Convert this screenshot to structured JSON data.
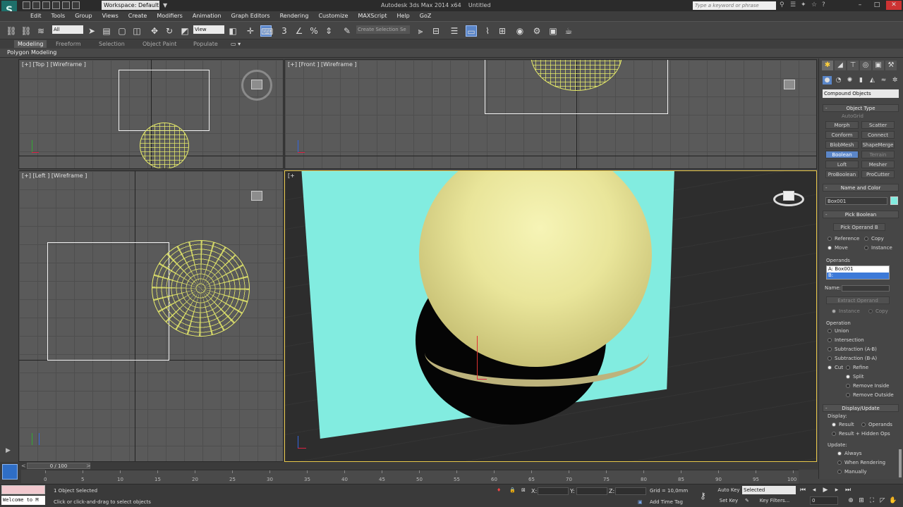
{
  "window": {
    "title": "Autodesk 3ds Max 2014 x64",
    "document": "Untitled",
    "workspace": "Workspace: Default",
    "search_placeholder": "Type a keyword or phrase"
  },
  "menu": [
    "Edit",
    "Tools",
    "Group",
    "Views",
    "Create",
    "Modifiers",
    "Animation",
    "Graph Editors",
    "Rendering",
    "Customize",
    "MAXScript",
    "Help",
    "GoZ"
  ],
  "toolbar": {
    "selection_filter": "All",
    "reference_coord": "View",
    "named_selection": "Create Selection Se"
  },
  "ribbon": {
    "tabs": [
      "Modeling",
      "Freeform",
      "Selection",
      "Object Paint",
      "Populate"
    ],
    "panel_label": "Polygon Modeling"
  },
  "viewports": {
    "top": "[+] [Top ] [Wireframe ]",
    "front": "[+] [Front ] [Wireframe ]",
    "left": "[+] [Left ] [Wireframe ]",
    "perspective": "[+"
  },
  "command_panel": {
    "category": "Compound Objects",
    "object_type_title": "Object Type",
    "autogrid_label": "AutoGrid",
    "object_types": [
      "Morph",
      "Scatter",
      "Conform",
      "Connect",
      "BlobMesh",
      "ShapeMerge",
      "Boolean",
      "Terrain",
      "Loft",
      "Mesher",
      "ProBoolean",
      "ProCutter"
    ],
    "active_type": "Boolean",
    "name_color_title": "Name and Color",
    "object_name": "Box001",
    "object_color": "#82ece0",
    "pick_boolean_title": "Pick Boolean",
    "pick_operand_label": "Pick Operand B",
    "pick_mode": [
      "Reference",
      "Copy",
      "Move",
      "Instance"
    ],
    "operands_title": "Operands",
    "operands": [
      "A: Box001",
      "B:"
    ],
    "name_label": "Name:",
    "extract_label": "Extract Operand",
    "extract_modes": [
      "Instance",
      "Copy"
    ],
    "operation_title": "Operation",
    "operations": [
      "Union",
      "Intersection",
      "Subtraction (A-B)",
      "Subtraction (B-A)",
      "Cut"
    ],
    "cut_modes": [
      "Refine",
      "Split",
      "Remove Inside",
      "Remove Outside"
    ],
    "display_update_title": "Display/Update",
    "display_label": "Display:",
    "display_options": [
      "Result",
      "Operands",
      "Result + Hidden Ops"
    ],
    "update_label": "Update:",
    "update_options": [
      "Always",
      "When Rendering",
      "Manually"
    ]
  },
  "timeline": {
    "frame_label": "0 / 100",
    "ticks": [
      "0",
      "5",
      "10",
      "15",
      "20",
      "25",
      "30",
      "35",
      "40",
      "45",
      "50",
      "55",
      "60",
      "65",
      "70",
      "75",
      "80",
      "85",
      "90",
      "95",
      "100"
    ]
  },
  "status": {
    "maxscript_text": "Welcome to M",
    "selection_info": "1 Object Selected",
    "prompt": "Click or click-and-drag to select objects",
    "x_label": "X:",
    "y_label": "Y:",
    "z_label": "Z:",
    "grid": "Grid = 10,0mm",
    "add_time_tag": "Add Time Tag",
    "auto_key": "Auto Key",
    "auto_key_mode": "Selected",
    "set_key": "Set Key",
    "key_filters": "Key Filters...",
    "current_frame": "0"
  }
}
